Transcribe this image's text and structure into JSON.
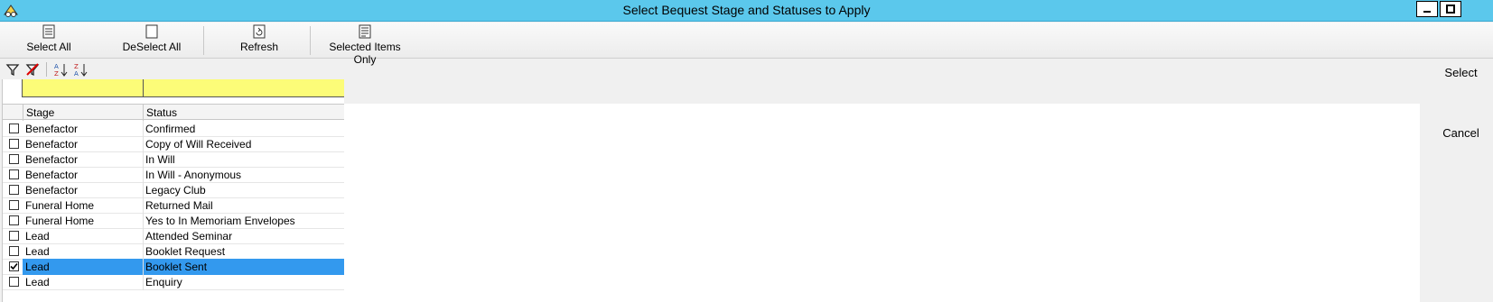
{
  "window": {
    "title": "Select Bequest Stage and Statuses to Apply",
    "icon": "bequest-app-icon"
  },
  "toolbar": {
    "select_all": "Select All",
    "deselect_all": "DeSelect All",
    "refresh": "Refresh",
    "selected_only": "Selected Items Only"
  },
  "grid": {
    "columns": [
      "Stage",
      "Status"
    ],
    "rows": [
      {
        "stage": "Benefactor",
        "status": "Confirmed",
        "checked": false
      },
      {
        "stage": "Benefactor",
        "status": "Copy of Will Received",
        "checked": false
      },
      {
        "stage": "Benefactor",
        "status": "In Will",
        "checked": false
      },
      {
        "stage": "Benefactor",
        "status": "In Will - Anonymous",
        "checked": false
      },
      {
        "stage": "Benefactor",
        "status": "Legacy Club",
        "checked": false
      },
      {
        "stage": "Funeral Home",
        "status": "Returned Mail",
        "checked": false
      },
      {
        "stage": "Funeral Home",
        "status": "Yes to In Memoriam Envelopes",
        "checked": false
      },
      {
        "stage": "Lead",
        "status": "Attended Seminar",
        "checked": false
      },
      {
        "stage": "Lead",
        "status": "Booklet Request",
        "checked": false
      },
      {
        "stage": "Lead",
        "status": "Booklet Sent",
        "checked": true
      },
      {
        "stage": "Lead",
        "status": "Enquiry",
        "checked": false
      }
    ]
  },
  "actions": {
    "select": "Select",
    "cancel": "Cancel"
  },
  "colors": {
    "titlebar": "#5bc8ec",
    "filter_row": "#fcfc78",
    "selection": "#3399ee"
  }
}
